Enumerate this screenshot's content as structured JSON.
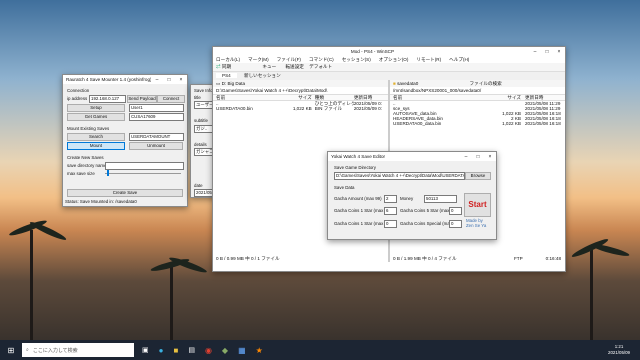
{
  "taskbar": {
    "search_placeholder": "ここに入力して検索",
    "time": "1:21",
    "date": "2021/05/09"
  },
  "mounter": {
    "title": "Rauratch 4 Save Mounter 1.4 (yoshinfrog)",
    "connection_label": "Connection",
    "ip_label": "ip address",
    "ip_value": "192.168.0.127",
    "send_payload": "Send Payload",
    "connect": "Connect",
    "setup": "Setup",
    "user_value": "User1",
    "get_games": "Get Games",
    "game_value": "CUSA17609",
    "mount_existing": "Mount Existing Saves",
    "search": "Search",
    "save_value": "USERDATAMOUNT",
    "mount": "Mount",
    "unmount": "Unmount",
    "create_new": "Create New Saves",
    "save_dir_label": "save directory name",
    "max_save_label": "max save size",
    "create_save": "Create Save",
    "status": "Status: Save Mounted in: /savedata0"
  },
  "partial": {
    "lines": [
      "Save Info",
      "title",
      "ユーザーP",
      "subtitle",
      "ガジ..",
      "details",
      "ガシャコン",
      "date",
      "2021/05"
    ]
  },
  "winscp": {
    "title": "Mod - PS4 - WinSCP",
    "menu": [
      "ローカル(L)",
      "マーク(M)",
      "ファイル(F)",
      "コマンド(C)",
      "セッション(S)",
      "オプション(O)",
      "リモート(R)",
      "ヘルプ(H)"
    ],
    "sync": "同期",
    "queue": "キュー",
    "transfer": "転送設定",
    "default": "デフォルト",
    "tab_ps4": "PS4",
    "tab_new": "新しいセッション",
    "left_path_label": "D: Big Data",
    "left_path": "D:\\Games\\Saves\\Yokai Watch 4 ++\\Decrypt\\Data\\Mod\\",
    "right_path_label": "savedata0",
    "right_path": "/mnt/sandbox/NPXS20001_000/savedata0/",
    "find_files": "ファイルの検索",
    "left_columns": [
      "名前",
      "サイズ",
      "種類",
      "更新日時"
    ],
    "left_rows": [
      [
        "..",
        "",
        "ひとつ上のディレクトリ",
        "2021/05/09 0:"
      ],
      [
        "USERDATA00.bin",
        "1,022 KB",
        "BIN ファイル",
        "2021/05/09 0:"
      ]
    ],
    "right_columns": [
      "名前",
      "サイズ",
      "更新日時"
    ],
    "right_rows": [
      [
        "..",
        "",
        "2021/05/08 11:29"
      ],
      [
        "sce_sys",
        "",
        "2021/05/08 11:29"
      ],
      [
        "AUTOSAVE_data.bin",
        "1,022 KB",
        "2021/05/08 16:18"
      ],
      [
        "HEADERSAVE_data.bin",
        "2 KB",
        "2021/05/08 16:18"
      ],
      [
        "USERDATA00_data.bin",
        "1,022 KB",
        "2021/05/08 16:18"
      ]
    ],
    "left_status": "0 B / 0.99 MB 中 0 / 1 ファイル",
    "right_status": "0 B / 1.99 MB 中 0 / 4 ファイル",
    "ftp": "FTP",
    "clock": "0:16:48"
  },
  "editor": {
    "title": "Yokai Watch 4 Save Editor",
    "dir_group": "Save Game Directory",
    "dir_value": "D:\\Games\\Saves\\Yokai Watch 4 ++\\Decrypt\\Data\\Mod\\USERDATA00_data",
    "browse": "Browse",
    "data_group": "Save Data",
    "fields": [
      {
        "label": "Gacha Amount (max 99)",
        "value": "2"
      },
      {
        "label": "Money",
        "value": "50113"
      },
      {
        "label": "Gacha Coins 1 Star (max 99)",
        "value": "6"
      },
      {
        "label": "Gacha Coins 5 Star (max 99)",
        "value": "0"
      },
      {
        "label": "Gacha Coins 1 Star (max 99)",
        "value": "0"
      },
      {
        "label": "Gacha Coins Special (max 99)",
        "value": "0"
      }
    ],
    "start": "Start",
    "credit": "Made by Zen Se Ya"
  }
}
